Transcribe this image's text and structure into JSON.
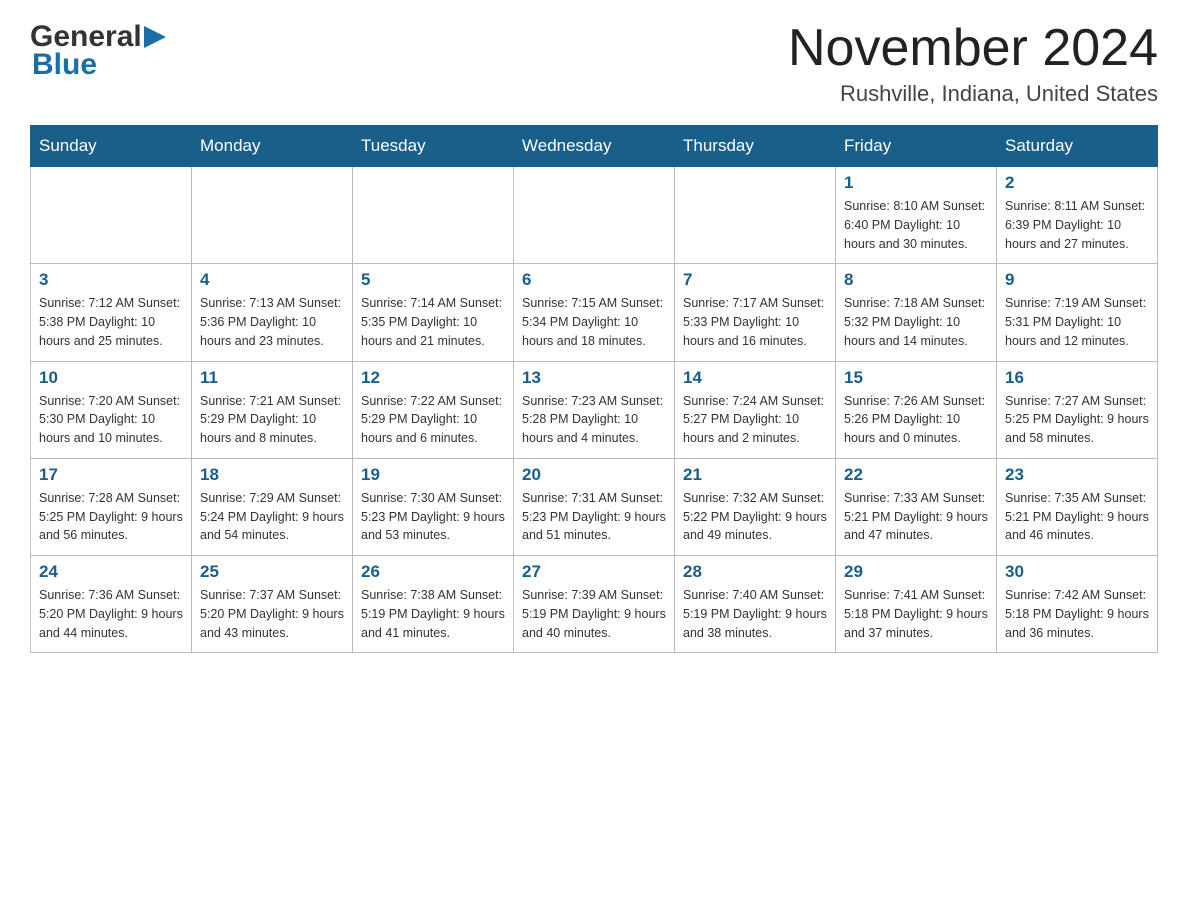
{
  "header": {
    "logo": {
      "general": "General",
      "blue": "Blue"
    },
    "title": "November 2024",
    "location": "Rushville, Indiana, United States"
  },
  "calendar": {
    "days_of_week": [
      "Sunday",
      "Monday",
      "Tuesday",
      "Wednesday",
      "Thursday",
      "Friday",
      "Saturday"
    ],
    "weeks": [
      [
        {
          "day": "",
          "info": ""
        },
        {
          "day": "",
          "info": ""
        },
        {
          "day": "",
          "info": ""
        },
        {
          "day": "",
          "info": ""
        },
        {
          "day": "",
          "info": ""
        },
        {
          "day": "1",
          "info": "Sunrise: 8:10 AM\nSunset: 6:40 PM\nDaylight: 10 hours and 30 minutes."
        },
        {
          "day": "2",
          "info": "Sunrise: 8:11 AM\nSunset: 6:39 PM\nDaylight: 10 hours and 27 minutes."
        }
      ],
      [
        {
          "day": "3",
          "info": "Sunrise: 7:12 AM\nSunset: 5:38 PM\nDaylight: 10 hours and 25 minutes."
        },
        {
          "day": "4",
          "info": "Sunrise: 7:13 AM\nSunset: 5:36 PM\nDaylight: 10 hours and 23 minutes."
        },
        {
          "day": "5",
          "info": "Sunrise: 7:14 AM\nSunset: 5:35 PM\nDaylight: 10 hours and 21 minutes."
        },
        {
          "day": "6",
          "info": "Sunrise: 7:15 AM\nSunset: 5:34 PM\nDaylight: 10 hours and 18 minutes."
        },
        {
          "day": "7",
          "info": "Sunrise: 7:17 AM\nSunset: 5:33 PM\nDaylight: 10 hours and 16 minutes."
        },
        {
          "day": "8",
          "info": "Sunrise: 7:18 AM\nSunset: 5:32 PM\nDaylight: 10 hours and 14 minutes."
        },
        {
          "day": "9",
          "info": "Sunrise: 7:19 AM\nSunset: 5:31 PM\nDaylight: 10 hours and 12 minutes."
        }
      ],
      [
        {
          "day": "10",
          "info": "Sunrise: 7:20 AM\nSunset: 5:30 PM\nDaylight: 10 hours and 10 minutes."
        },
        {
          "day": "11",
          "info": "Sunrise: 7:21 AM\nSunset: 5:29 PM\nDaylight: 10 hours and 8 minutes."
        },
        {
          "day": "12",
          "info": "Sunrise: 7:22 AM\nSunset: 5:29 PM\nDaylight: 10 hours and 6 minutes."
        },
        {
          "day": "13",
          "info": "Sunrise: 7:23 AM\nSunset: 5:28 PM\nDaylight: 10 hours and 4 minutes."
        },
        {
          "day": "14",
          "info": "Sunrise: 7:24 AM\nSunset: 5:27 PM\nDaylight: 10 hours and 2 minutes."
        },
        {
          "day": "15",
          "info": "Sunrise: 7:26 AM\nSunset: 5:26 PM\nDaylight: 10 hours and 0 minutes."
        },
        {
          "day": "16",
          "info": "Sunrise: 7:27 AM\nSunset: 5:25 PM\nDaylight: 9 hours and 58 minutes."
        }
      ],
      [
        {
          "day": "17",
          "info": "Sunrise: 7:28 AM\nSunset: 5:25 PM\nDaylight: 9 hours and 56 minutes."
        },
        {
          "day": "18",
          "info": "Sunrise: 7:29 AM\nSunset: 5:24 PM\nDaylight: 9 hours and 54 minutes."
        },
        {
          "day": "19",
          "info": "Sunrise: 7:30 AM\nSunset: 5:23 PM\nDaylight: 9 hours and 53 minutes."
        },
        {
          "day": "20",
          "info": "Sunrise: 7:31 AM\nSunset: 5:23 PM\nDaylight: 9 hours and 51 minutes."
        },
        {
          "day": "21",
          "info": "Sunrise: 7:32 AM\nSunset: 5:22 PM\nDaylight: 9 hours and 49 minutes."
        },
        {
          "day": "22",
          "info": "Sunrise: 7:33 AM\nSunset: 5:21 PM\nDaylight: 9 hours and 47 minutes."
        },
        {
          "day": "23",
          "info": "Sunrise: 7:35 AM\nSunset: 5:21 PM\nDaylight: 9 hours and 46 minutes."
        }
      ],
      [
        {
          "day": "24",
          "info": "Sunrise: 7:36 AM\nSunset: 5:20 PM\nDaylight: 9 hours and 44 minutes."
        },
        {
          "day": "25",
          "info": "Sunrise: 7:37 AM\nSunset: 5:20 PM\nDaylight: 9 hours and 43 minutes."
        },
        {
          "day": "26",
          "info": "Sunrise: 7:38 AM\nSunset: 5:19 PM\nDaylight: 9 hours and 41 minutes."
        },
        {
          "day": "27",
          "info": "Sunrise: 7:39 AM\nSunset: 5:19 PM\nDaylight: 9 hours and 40 minutes."
        },
        {
          "day": "28",
          "info": "Sunrise: 7:40 AM\nSunset: 5:19 PM\nDaylight: 9 hours and 38 minutes."
        },
        {
          "day": "29",
          "info": "Sunrise: 7:41 AM\nSunset: 5:18 PM\nDaylight: 9 hours and 37 minutes."
        },
        {
          "day": "30",
          "info": "Sunrise: 7:42 AM\nSunset: 5:18 PM\nDaylight: 9 hours and 36 minutes."
        }
      ]
    ]
  }
}
